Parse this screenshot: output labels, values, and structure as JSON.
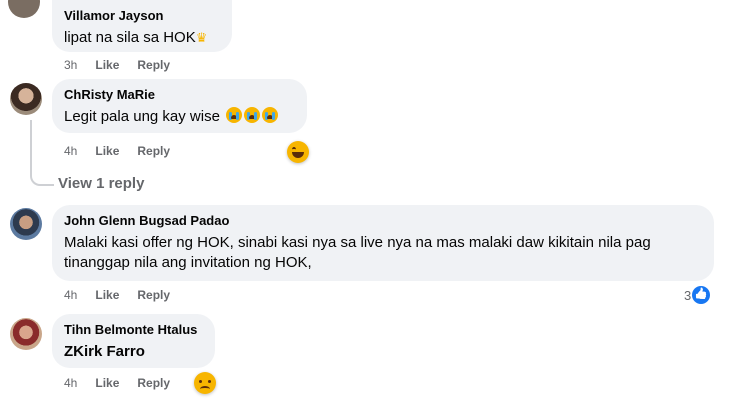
{
  "comments": [
    {
      "author": "Villamor Jayson",
      "text": "lipat na sila sa HOK",
      "time": "3h",
      "like": "Like",
      "reply": "Reply"
    },
    {
      "author": "ChRisty MaRie",
      "text": "Legit pala ung kay wise",
      "time": "4h",
      "like": "Like",
      "reply": "Reply",
      "view_replies": "View 1 reply"
    },
    {
      "author": "John Glenn Bugsad Padao",
      "text_line1": "Malaki kasi offer ng HOK, sinabi kasi nya sa live nya na mas malaki daw kikitain nila pag",
      "text_line2": "tinanggap nila ang invitation ng HOK,",
      "time": "4h",
      "like": "Like",
      "reply": "Reply",
      "reaction_count": "3"
    },
    {
      "author": "Tihn Belmonte Htalus",
      "text": "ZKirk Farro",
      "time": "4h",
      "like": "Like",
      "reply": "Reply"
    }
  ],
  "colors": {
    "bubble": "#f0f2f5",
    "meta": "#65676b",
    "like_blue": "#1877f2"
  }
}
